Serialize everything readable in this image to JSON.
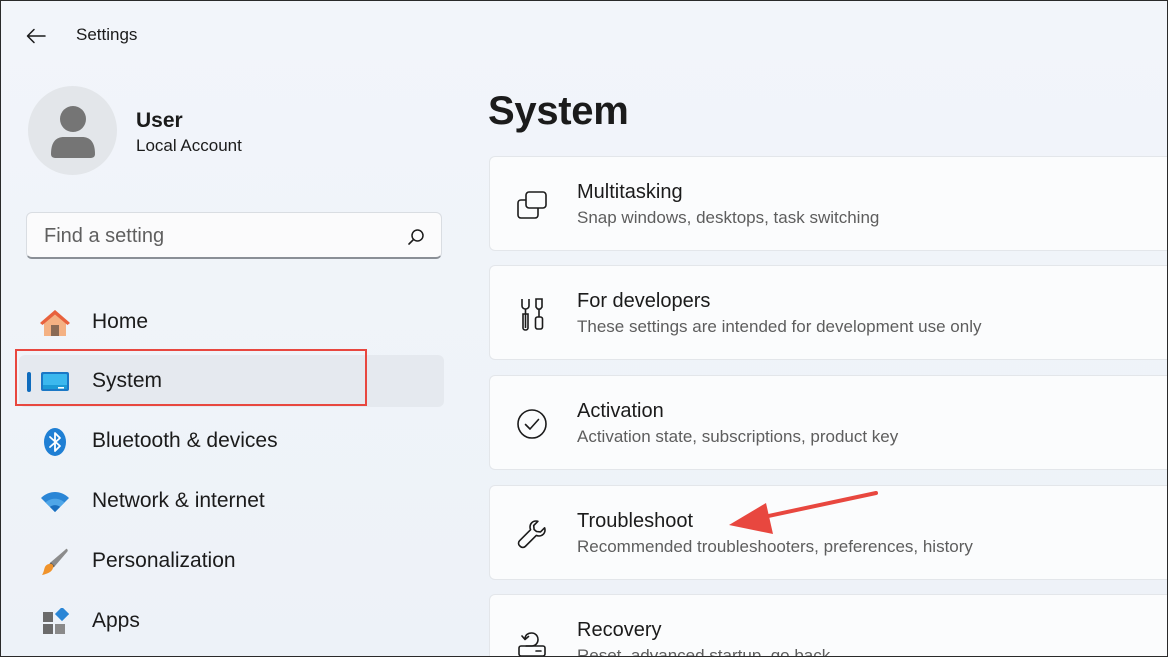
{
  "titlebar": {
    "title": "Settings"
  },
  "user": {
    "name": "User",
    "account_type": "Local Account"
  },
  "search": {
    "placeholder": "Find a setting"
  },
  "nav": {
    "items": [
      {
        "label": "Home",
        "icon": "home-icon"
      },
      {
        "label": "System",
        "icon": "system-monitor-icon",
        "selected": true
      },
      {
        "label": "Bluetooth & devices",
        "icon": "bluetooth-icon"
      },
      {
        "label": "Network & internet",
        "icon": "wifi-icon"
      },
      {
        "label": "Personalization",
        "icon": "paintbrush-icon"
      },
      {
        "label": "Apps",
        "icon": "apps-icon"
      }
    ]
  },
  "main": {
    "title": "System",
    "cards": [
      {
        "title": "Multitasking",
        "subtitle": "Snap windows, desktops, task switching",
        "icon": "multitasking-icon"
      },
      {
        "title": "For developers",
        "subtitle": "These settings are intended for development use only",
        "icon": "developer-tools-icon"
      },
      {
        "title": "Activation",
        "subtitle": "Activation state, subscriptions, product key",
        "icon": "checkmark-circle-icon"
      },
      {
        "title": "Troubleshoot",
        "subtitle": "Recommended troubleshooters, preferences, history",
        "icon": "wrench-icon"
      },
      {
        "title": "Recovery",
        "subtitle": "Reset, advanced startup, go back",
        "icon": "recovery-icon"
      }
    ]
  },
  "colors": {
    "accent": "#0f6cbd",
    "highlight": "#e8473f",
    "background": "#eef3f9"
  }
}
